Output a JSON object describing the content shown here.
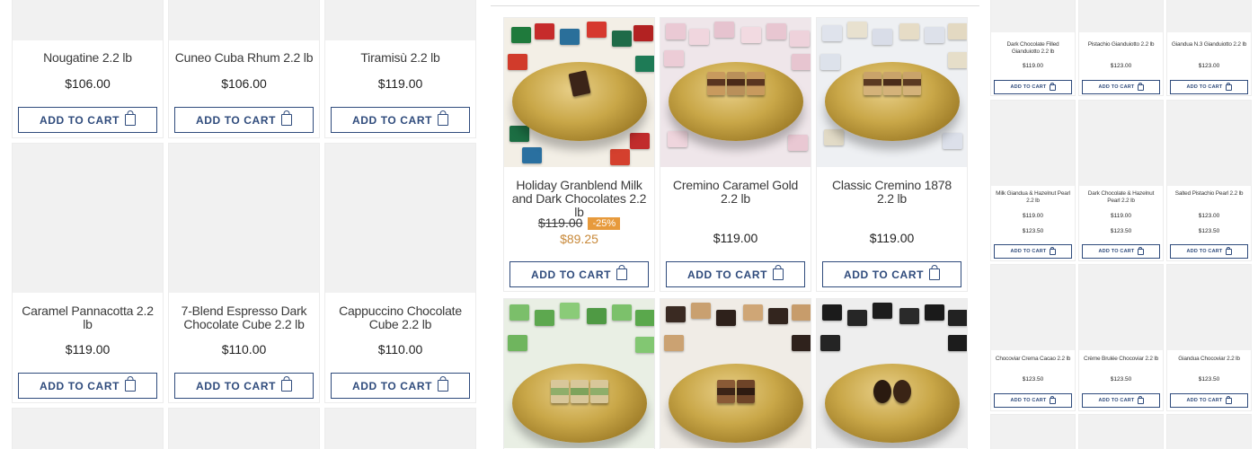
{
  "colors": {
    "accent": "#2f4b7c",
    "discount_badge": "#e79a3c",
    "sale_price": "#c8893a",
    "card_border": "#ececec",
    "image_placeholder": "#f1f1f1"
  },
  "cart_label": "ADD TO CART",
  "cart_icon": "shopping-bag-icon",
  "left_grid": [
    {
      "name": "Nougatine 2.2 lb",
      "price": "$106.00"
    },
    {
      "name": "Cuneo Cuba Rhum 2.2 lb",
      "price": "$106.00"
    },
    {
      "name": "Tiramisù 2.2 lb",
      "price": "$119.00"
    },
    {
      "name": "Caramel Pannacotta 2.2 lb",
      "price": "$119.00"
    },
    {
      "name": "7-Blend Espresso Dark Chocolate Cube 2.2 lb",
      "price": "$110.00"
    },
    {
      "name": "Cappuccino Chocolate Cube 2.2 lb",
      "price": "$110.00"
    }
  ],
  "middle_grid": [
    {
      "name": "Holiday Granblend Milk and Dark Chocolates 2.2 lb",
      "old_price": "$119.00",
      "discount": "-25%",
      "price": "$89.25"
    },
    {
      "name": "Cremino Caramel Gold 2.2 lb",
      "price": "$119.00"
    },
    {
      "name": "Classic Cremino 1878 2.2 lb",
      "price": "$119.00"
    }
  ],
  "right_grid": [
    {
      "name": "Dark Chocolate Filled Gianduiotto 2.2 lb",
      "prices": [
        "$119.00"
      ]
    },
    {
      "name": "Pistachio Gianduiotto 2.2 lb",
      "prices": [
        "$123.00"
      ]
    },
    {
      "name": "Giandua N.3 Gianduiotto 2.2 lb",
      "prices": [
        "$123.00"
      ]
    },
    {
      "name": "Milk Giandua & Hazelnut Pearl 2.2 lb",
      "prices": [
        "$119.00",
        "$123.50"
      ]
    },
    {
      "name": "Dark Chocolate & Hazelnut Pearl 2.2 lb",
      "prices": [
        "$119.00",
        "$123.50"
      ]
    },
    {
      "name": "Salted Pistachio Pearl 2.2 lb",
      "prices": [
        "$123.00",
        "$123.50"
      ]
    },
    {
      "name": "Chocoviar Crema Cacao 2.2 lb",
      "prices": [
        "$123.50"
      ]
    },
    {
      "name": "Crème Brulée Chocoviar 2.2 lb",
      "prices": [
        "$123.50"
      ]
    },
    {
      "name": "Giandua Chocoviar 2.2 lb",
      "prices": [
        "$123.50"
      ]
    }
  ]
}
